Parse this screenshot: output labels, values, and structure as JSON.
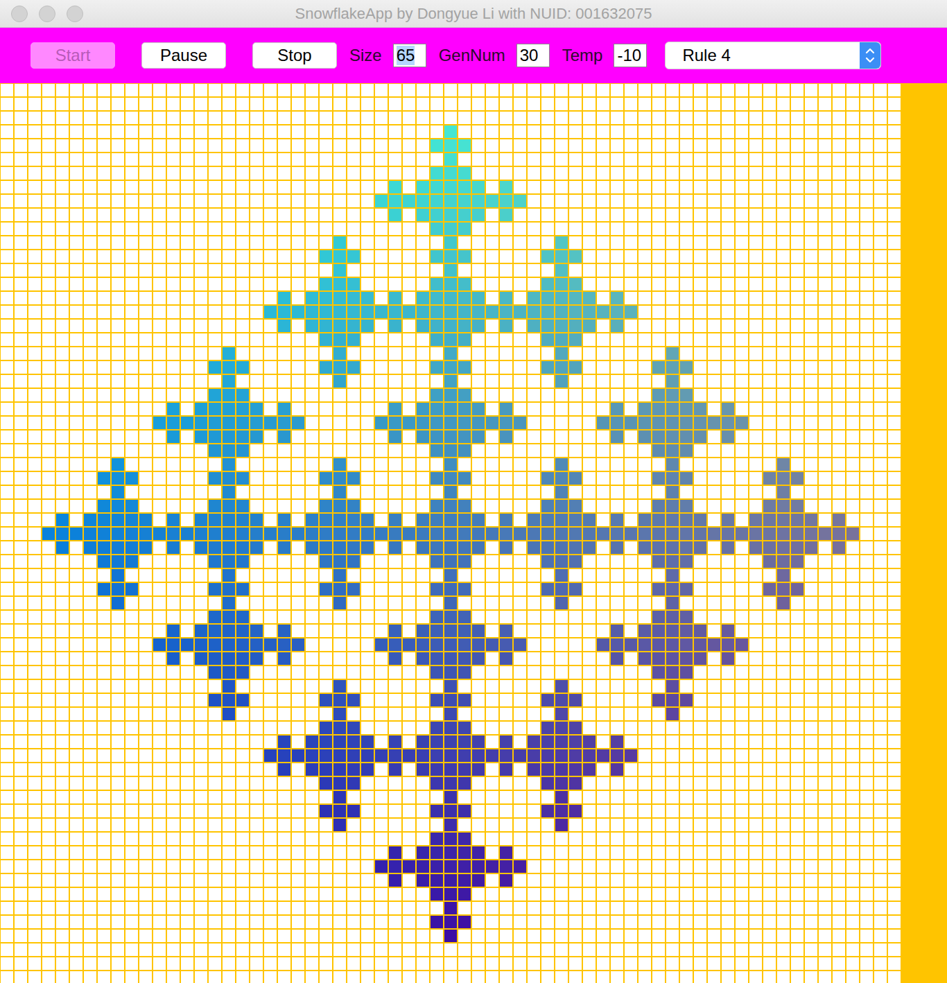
{
  "window": {
    "title": "SnowflakeApp by Dongyue Li with NUID: 001632075"
  },
  "toolbar": {
    "buttons": [
      {
        "label": "Start",
        "disabled": true
      },
      {
        "label": "Pause",
        "disabled": false
      },
      {
        "label": "Stop",
        "disabled": false
      }
    ],
    "fields": [
      {
        "label": "Size",
        "value": "65",
        "selected": true
      },
      {
        "label": "GenNum",
        "value": "30",
        "selected": false
      },
      {
        "label": "Temp",
        "value": "-10",
        "selected": false
      }
    ],
    "rule_dropdown": {
      "value": "Rule 4"
    }
  },
  "grid": {
    "rows": [
      [],
      [],
      [],
      [
        32
      ],
      [
        31,
        32,
        33
      ],
      [
        32
      ],
      [
        31,
        32,
        33
      ],
      [
        28,
        30,
        31,
        32,
        33,
        34,
        36
      ],
      [
        27,
        28,
        29,
        30,
        31,
        32,
        33,
        34,
        35,
        36,
        37
      ],
      [
        28,
        30,
        31,
        32,
        33,
        34,
        36
      ],
      [
        31,
        32,
        33
      ],
      [
        24,
        32,
        40
      ],
      [
        23,
        24,
        25,
        31,
        32,
        33,
        39,
        40,
        41
      ],
      [
        24,
        32,
        40
      ],
      [
        23,
        24,
        25,
        31,
        32,
        33,
        39,
        40,
        41
      ],
      [
        20,
        22,
        23,
        24,
        25,
        26,
        28,
        30,
        31,
        32,
        33,
        34,
        36,
        38,
        39,
        40,
        41,
        42,
        44
      ],
      [
        19,
        20,
        21,
        22,
        23,
        24,
        25,
        26,
        27,
        28,
        29,
        30,
        31,
        32,
        33,
        34,
        35,
        36,
        37,
        38,
        39,
        40,
        41,
        42,
        43,
        44,
        45
      ],
      [
        20,
        22,
        23,
        24,
        25,
        26,
        28,
        30,
        31,
        32,
        33,
        34,
        36,
        38,
        39,
        40,
        41,
        42,
        44
      ],
      [
        23,
        24,
        25,
        31,
        32,
        33,
        39,
        40,
        41
      ],
      [
        16,
        24,
        32,
        40,
        48
      ],
      [
        15,
        16,
        17,
        23,
        24,
        25,
        31,
        32,
        33,
        39,
        40,
        41,
        47,
        48,
        49
      ],
      [
        16,
        24,
        32,
        40,
        48
      ],
      [
        15,
        16,
        17,
        31,
        32,
        33,
        47,
        48,
        49
      ],
      [
        12,
        14,
        15,
        16,
        17,
        18,
        20,
        28,
        30,
        31,
        32,
        33,
        34,
        36,
        44,
        46,
        47,
        48,
        49,
        50,
        52
      ],
      [
        11,
        12,
        13,
        14,
        15,
        16,
        17,
        18,
        19,
        20,
        21,
        27,
        28,
        29,
        30,
        31,
        32,
        33,
        34,
        35,
        36,
        37,
        43,
        44,
        45,
        46,
        47,
        48,
        49,
        50,
        51,
        52,
        53
      ],
      [
        12,
        14,
        15,
        16,
        17,
        18,
        20,
        28,
        30,
        31,
        32,
        33,
        34,
        36,
        44,
        46,
        47,
        48,
        49,
        50,
        52
      ],
      [
        15,
        16,
        17,
        31,
        32,
        33,
        47,
        48,
        49
      ],
      [
        8,
        16,
        24,
        32,
        40,
        48,
        56
      ],
      [
        7,
        8,
        9,
        15,
        16,
        17,
        23,
        24,
        25,
        31,
        32,
        33,
        39,
        40,
        41,
        47,
        48,
        49,
        55,
        56,
        57
      ],
      [
        8,
        16,
        24,
        32,
        40,
        48,
        56
      ],
      [
        7,
        8,
        9,
        15,
        16,
        17,
        23,
        24,
        25,
        31,
        32,
        33,
        39,
        40,
        41,
        47,
        48,
        49,
        55,
        56,
        57
      ],
      [
        4,
        6,
        7,
        8,
        9,
        10,
        12,
        14,
        15,
        16,
        17,
        18,
        20,
        22,
        23,
        24,
        25,
        26,
        28,
        30,
        31,
        32,
        33,
        34,
        36,
        38,
        39,
        40,
        41,
        42,
        44,
        46,
        47,
        48,
        49,
        50,
        52,
        54,
        55,
        56,
        57,
        58,
        60
      ],
      [
        3,
        4,
        5,
        6,
        7,
        8,
        9,
        10,
        11,
        12,
        13,
        14,
        15,
        16,
        17,
        18,
        19,
        20,
        21,
        22,
        23,
        24,
        25,
        26,
        27,
        28,
        29,
        30,
        31,
        32,
        33,
        34,
        35,
        36,
        37,
        38,
        39,
        40,
        41,
        42,
        43,
        44,
        45,
        46,
        47,
        48,
        49,
        50,
        51,
        52,
        53,
        54,
        55,
        56,
        57,
        58,
        59,
        60,
        61
      ],
      [
        4,
        6,
        7,
        8,
        9,
        10,
        12,
        14,
        15,
        16,
        17,
        18,
        20,
        22,
        23,
        24,
        25,
        26,
        28,
        30,
        31,
        32,
        33,
        34,
        36,
        38,
        39,
        40,
        41,
        42,
        44,
        46,
        47,
        48,
        49,
        50,
        52,
        54,
        55,
        56,
        57,
        58,
        60
      ],
      [
        7,
        8,
        9,
        15,
        16,
        17,
        23,
        24,
        25,
        31,
        32,
        33,
        39,
        40,
        41,
        47,
        48,
        49,
        55,
        56,
        57
      ],
      [
        8,
        16,
        24,
        32,
        40,
        48,
        56
      ],
      [
        7,
        8,
        9,
        15,
        16,
        17,
        23,
        24,
        25,
        31,
        32,
        33,
        39,
        40,
        41,
        47,
        48,
        49,
        55,
        56,
        57
      ],
      [
        8,
        16,
        24,
        32,
        40,
        48,
        56
      ],
      [
        15,
        16,
        17,
        31,
        32,
        33,
        47,
        48,
        49
      ],
      [
        12,
        14,
        15,
        16,
        17,
        18,
        20,
        28,
        30,
        31,
        32,
        33,
        34,
        36,
        44,
        46,
        47,
        48,
        49,
        50,
        52
      ],
      [
        11,
        12,
        13,
        14,
        15,
        16,
        17,
        18,
        19,
        20,
        21,
        27,
        28,
        29,
        30,
        31,
        32,
        33,
        34,
        35,
        36,
        37,
        43,
        44,
        45,
        46,
        47,
        48,
        49,
        50,
        51,
        52,
        53
      ],
      [
        12,
        14,
        15,
        16,
        17,
        18,
        20,
        28,
        30,
        31,
        32,
        33,
        34,
        36,
        44,
        46,
        47,
        48,
        49,
        50,
        52
      ],
      [
        15,
        16,
        17,
        31,
        32,
        33,
        47,
        48,
        49
      ],
      [
        16,
        24,
        32,
        40,
        48
      ],
      [
        15,
        16,
        17,
        23,
        24,
        25,
        31,
        32,
        33,
        39,
        40,
        41,
        47,
        48,
        49
      ],
      [
        16,
        24,
        32,
        40,
        48
      ],
      [
        23,
        24,
        25,
        31,
        32,
        33,
        39,
        40,
        41
      ],
      [
        20,
        22,
        23,
        24,
        25,
        26,
        28,
        30,
        31,
        32,
        33,
        34,
        36,
        38,
        39,
        40,
        41,
        42,
        44
      ],
      [
        19,
        20,
        21,
        22,
        23,
        24,
        25,
        26,
        27,
        28,
        29,
        30,
        31,
        32,
        33,
        34,
        35,
        36,
        37,
        38,
        39,
        40,
        41,
        42,
        43,
        44,
        45
      ],
      [
        20,
        22,
        23,
        24,
        25,
        26,
        28,
        30,
        31,
        32,
        33,
        34,
        36,
        38,
        39,
        40,
        41,
        42,
        44
      ],
      [
        23,
        24,
        25,
        31,
        32,
        33,
        39,
        40,
        41
      ],
      [
        24,
        32,
        40
      ],
      [
        23,
        24,
        25,
        31,
        32,
        33,
        39,
        40,
        41
      ],
      [
        24,
        32,
        40
      ],
      [
        31,
        32,
        33
      ],
      [
        28,
        30,
        31,
        32,
        33,
        34,
        36
      ],
      [
        27,
        28,
        29,
        30,
        31,
        32,
        33,
        34,
        35,
        36,
        37
      ],
      [
        28,
        30,
        31,
        32,
        33,
        34,
        36
      ],
      [
        31,
        32,
        33
      ],
      [
        32
      ],
      [
        31,
        32,
        33
      ],
      [
        32
      ],
      [],
      [],
      []
    ]
  }
}
